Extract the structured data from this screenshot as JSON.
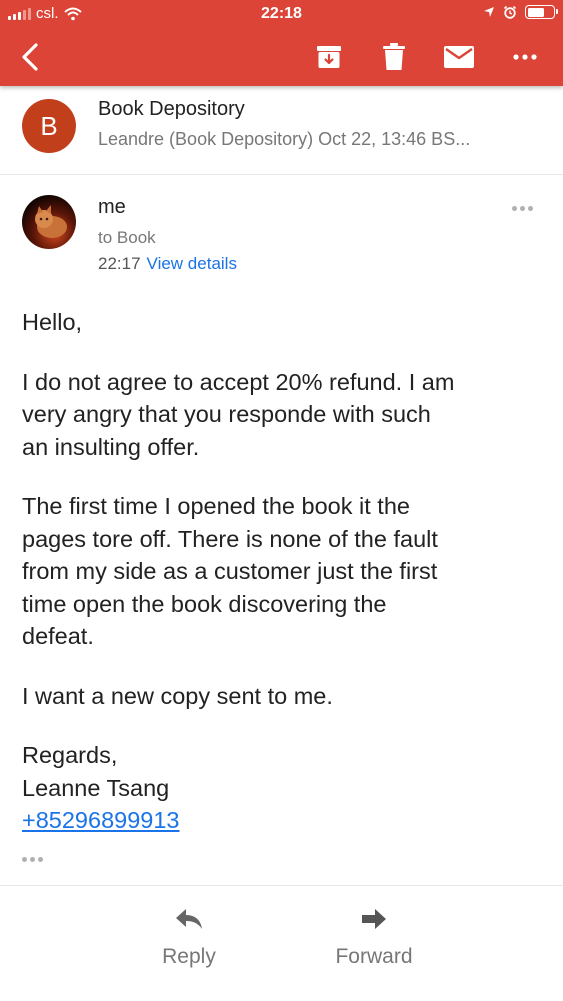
{
  "status_bar": {
    "carrier": "csl.",
    "time": "22:18"
  },
  "toolbar": {
    "back_icon": "back-arrow-icon",
    "archive_icon": "archive-icon",
    "delete_icon": "trash-icon",
    "mark_unread_icon": "mail-icon",
    "more_icon": "more-horizontal-icon",
    "accent_color": "#db4437"
  },
  "thread_header": {
    "avatar_letter": "B",
    "avatar_color": "#c13f1b",
    "sender": "Book Depository",
    "subline": "Leandre (Book Depository) Oct 22, 13:46 BS..."
  },
  "message": {
    "from": "me",
    "to": "to Book",
    "time": "22:17",
    "view_details": "View details",
    "body": {
      "greeting": "Hello,",
      "p1": [
        "I do not agree to accept 20% refund.  I am",
        "very angry that you responde with such",
        "an insulting offer."
      ],
      "p2": [
        "The first time I opened the book it the",
        "pages tore off.  There is none of the fault",
        "from my side as a customer just the first",
        "time open the book discovering the",
        "defeat."
      ],
      "p3": "I want a new copy sent to me.",
      "sign_off": "Regards,",
      "name": "Leanne Tsang",
      "phone": "+85296899913"
    }
  },
  "actions": {
    "reply": "Reply",
    "forward": "Forward"
  }
}
